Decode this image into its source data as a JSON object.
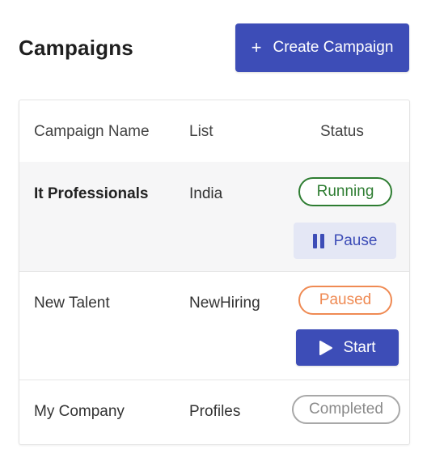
{
  "header": {
    "title": "Campaigns",
    "create_button": {
      "icon": "plus-icon",
      "label": "Create Campaign"
    }
  },
  "table": {
    "columns": [
      "Campaign Name",
      "List",
      "Status"
    ],
    "rows": [
      {
        "name": "It Professionals",
        "list": "India",
        "status": "Running",
        "action": {
          "label": "Pause",
          "icon": "pause-icon"
        }
      },
      {
        "name": "New Talent",
        "list": "NewHiring",
        "status": "Paused",
        "action": {
          "label": "Start",
          "icon": "play-icon"
        }
      },
      {
        "name": "My Company",
        "list": "Profiles",
        "status": "Completed"
      }
    ]
  },
  "colors": {
    "primary": "#3d4db7",
    "running": "#2e7d32",
    "paused": "#ef8a53",
    "completed": "#a8a8a8"
  }
}
